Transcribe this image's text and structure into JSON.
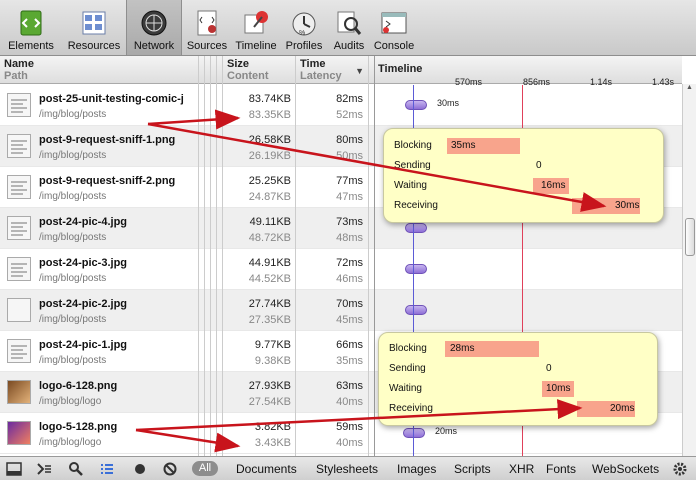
{
  "toolbar": {
    "items": [
      {
        "label": "Elements",
        "icon": "elements-icon"
      },
      {
        "label": "Resources",
        "icon": "resources-icon"
      },
      {
        "label": "Network",
        "icon": "network-icon",
        "active": true
      },
      {
        "label": "Sources",
        "icon": "sources-icon"
      },
      {
        "label": "Timeline",
        "icon": "timeline-icon"
      },
      {
        "label": "Profiles",
        "icon": "profiles-icon"
      },
      {
        "label": "Audits",
        "icon": "audits-icon"
      },
      {
        "label": "Console",
        "icon": "console-icon"
      }
    ]
  },
  "header": {
    "name": "Name",
    "path": "Path",
    "size": "Size",
    "content": "Content",
    "time": "Time",
    "latency": "Latency",
    "timeline": "Timeline",
    "ticks": [
      "570ms",
      "856ms",
      "1.14s",
      "1.43s"
    ]
  },
  "rows": [
    {
      "name": "post-25-unit-testing-comic-j",
      "path": "/img/blog/posts",
      "size": "83.74KB",
      "content": "83.35KB",
      "time": "82ms",
      "latency": "52ms",
      "thumb": "doc",
      "label": "30ms"
    },
    {
      "name": "post-9-request-sniff-1.png",
      "path": "/img/blog/posts",
      "size": "26.58KB",
      "content": "26.19KB",
      "time": "80ms",
      "latency": "50ms",
      "thumb": "doc"
    },
    {
      "name": "post-9-request-sniff-2.png",
      "path": "/img/blog/posts",
      "size": "25.25KB",
      "content": "24.87KB",
      "time": "77ms",
      "latency": "47ms",
      "thumb": "doc"
    },
    {
      "name": "post-24-pic-4.jpg",
      "path": "/img/blog/posts",
      "size": "49.11KB",
      "content": "48.72KB",
      "time": "73ms",
      "latency": "48ms",
      "thumb": "doc"
    },
    {
      "name": "post-24-pic-3.jpg",
      "path": "/img/blog/posts",
      "size": "44.91KB",
      "content": "44.52KB",
      "time": "72ms",
      "latency": "46ms",
      "thumb": "doc"
    },
    {
      "name": "post-24-pic-2.jpg",
      "path": "/img/blog/posts",
      "size": "27.74KB",
      "content": "27.35KB",
      "time": "70ms",
      "latency": "45ms",
      "thumb": "blank"
    },
    {
      "name": "post-24-pic-1.jpg",
      "path": "/img/blog/posts",
      "size": "9.77KB",
      "content": "9.38KB",
      "time": "66ms",
      "latency": "35ms",
      "thumb": "doc"
    },
    {
      "name": "logo-6-128.png",
      "path": "/img/blog/logo",
      "size": "27.93KB",
      "content": "27.54KB",
      "time": "63ms",
      "latency": "40ms",
      "thumb": "logo"
    },
    {
      "name": "logo-5-128.png",
      "path": "/img/blog/logo",
      "size": "3.82KB",
      "content": "3.43KB",
      "time": "59ms",
      "latency": "40ms",
      "thumb": "logo2",
      "label": "20ms"
    }
  ],
  "popover1": {
    "blocking_label": "Blocking",
    "blocking": "35ms",
    "sending_label": "Sending",
    "sending": "0",
    "waiting_label": "Waiting",
    "waiting": "16ms",
    "receiving_label": "Receiving",
    "receiving": "30ms"
  },
  "popover2": {
    "blocking_label": "Blocking",
    "blocking": "28ms",
    "sending_label": "Sending",
    "sending": "0",
    "waiting_label": "Waiting",
    "waiting": "10ms",
    "receiving_label": "Receiving",
    "receiving": "20ms"
  },
  "bottom": {
    "all": "All",
    "filters": [
      "Documents",
      "Stylesheets",
      "Images",
      "Scripts",
      "XHR",
      "Fonts",
      "WebSockets"
    ]
  },
  "colors": {
    "annotation_arrow": "#c8141c",
    "timeline_blue": "#5b5bd6",
    "timeline_red": "#e0405a",
    "popover_bar": "#f8a48c"
  }
}
